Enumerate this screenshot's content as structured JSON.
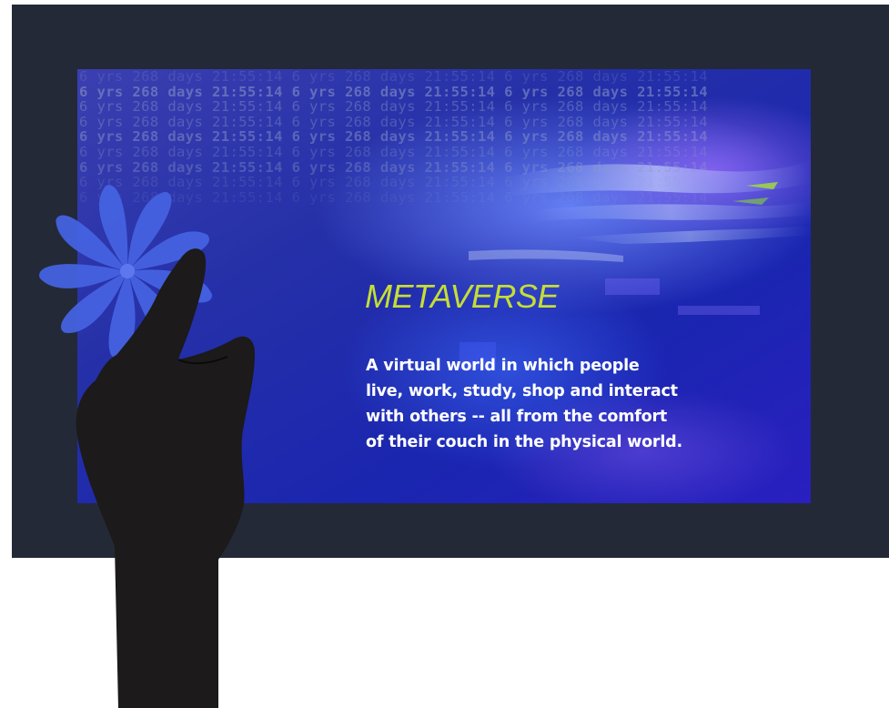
{
  "ticker": {
    "text": "6 yrs 268 days 21:55:14 6 yrs 268 days 21:55:14 6 yrs 268 days 21:55:14",
    "rows": 9
  },
  "headline": "METAVERSE",
  "description": "A virtual world in which people\nlive, work, study, shop and interact\nwith others  -- all from the comfort\nof their couch in the physical world.",
  "colors": {
    "frame": "#232937",
    "screen_base": "#1f2a9c",
    "headline": "#c6dd36",
    "body_text": "#ffffff",
    "ticker_text": "#8d9bc8",
    "flower": "#4562e0",
    "hand": "#1c1a1a"
  },
  "icons": [
    "flower-icon",
    "hand-icon"
  ]
}
